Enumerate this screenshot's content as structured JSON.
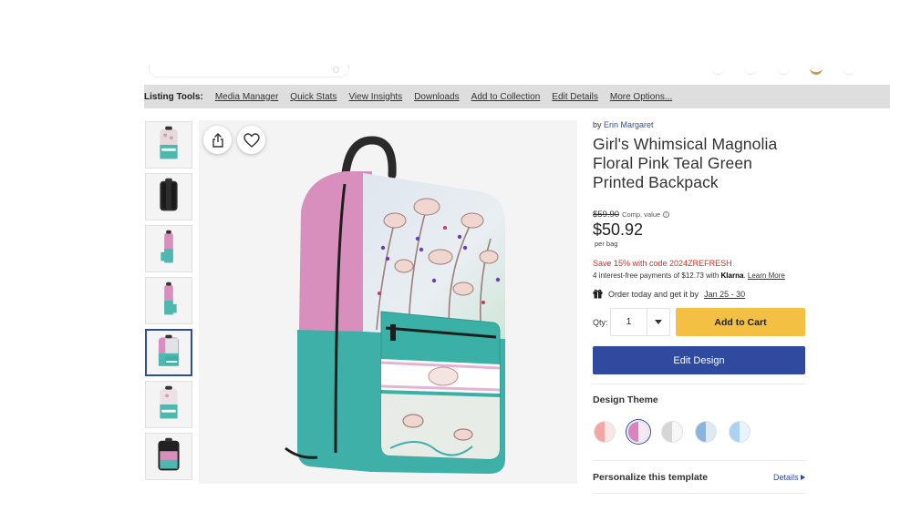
{
  "tools_bar": {
    "title": "Listing Tools:",
    "links": [
      "Media Manager",
      "Quick Stats",
      "View Insights",
      "Downloads",
      "Add to Collection",
      "Edit Details",
      "More Options..."
    ]
  },
  "product": {
    "by_prefix": "by",
    "author": "Erin Margaret",
    "title": "Girl's Whimsical Magnolia Floral Pink Teal Green Printed Backpack",
    "compare_price": "$59.90",
    "compare_label": "Comp. value",
    "price": "$50.92",
    "price_unit": "per bag",
    "promo": "Save 15% with code 2024ZREFRESH",
    "klarna_text": "4 interest-free payments of $12.73 with",
    "klarna_brand": "Klarna",
    "klarna_link": "Learn More",
    "delivery_text": "Order today and get it by",
    "delivery_date": "Jan 25 - 30",
    "qty_label": "Qty:",
    "qty_value": "1",
    "add_to_cart": "Add to Cart",
    "edit_design": "Edit Design",
    "design_theme_title": "Design Theme",
    "personalize_title": "Personalize this template",
    "details_link": "Details"
  },
  "swatches": [
    {
      "left": "#f4a6a6",
      "right": "#f7e6e6"
    },
    {
      "left": "#d984bf",
      "right": "#f5e8f2"
    },
    {
      "left": "#d6d6d6",
      "right": "#f7f7f7"
    },
    {
      "left": "#8ab4e0",
      "right": "#dde9f5"
    },
    {
      "left": "#a9d3f1",
      "right": "#e8f3fb"
    }
  ],
  "colors": {
    "accent_blue": "#2f4a9e",
    "cart_yellow": "#f4c043",
    "promo_red": "#d0312d",
    "bag_pink": "#d98fbd",
    "bag_teal": "#3fb0a8"
  },
  "icons": [
    "share-icon",
    "heart-icon",
    "info-icon",
    "gift-icon",
    "chevron-down-icon",
    "chevron-right-icon"
  ]
}
